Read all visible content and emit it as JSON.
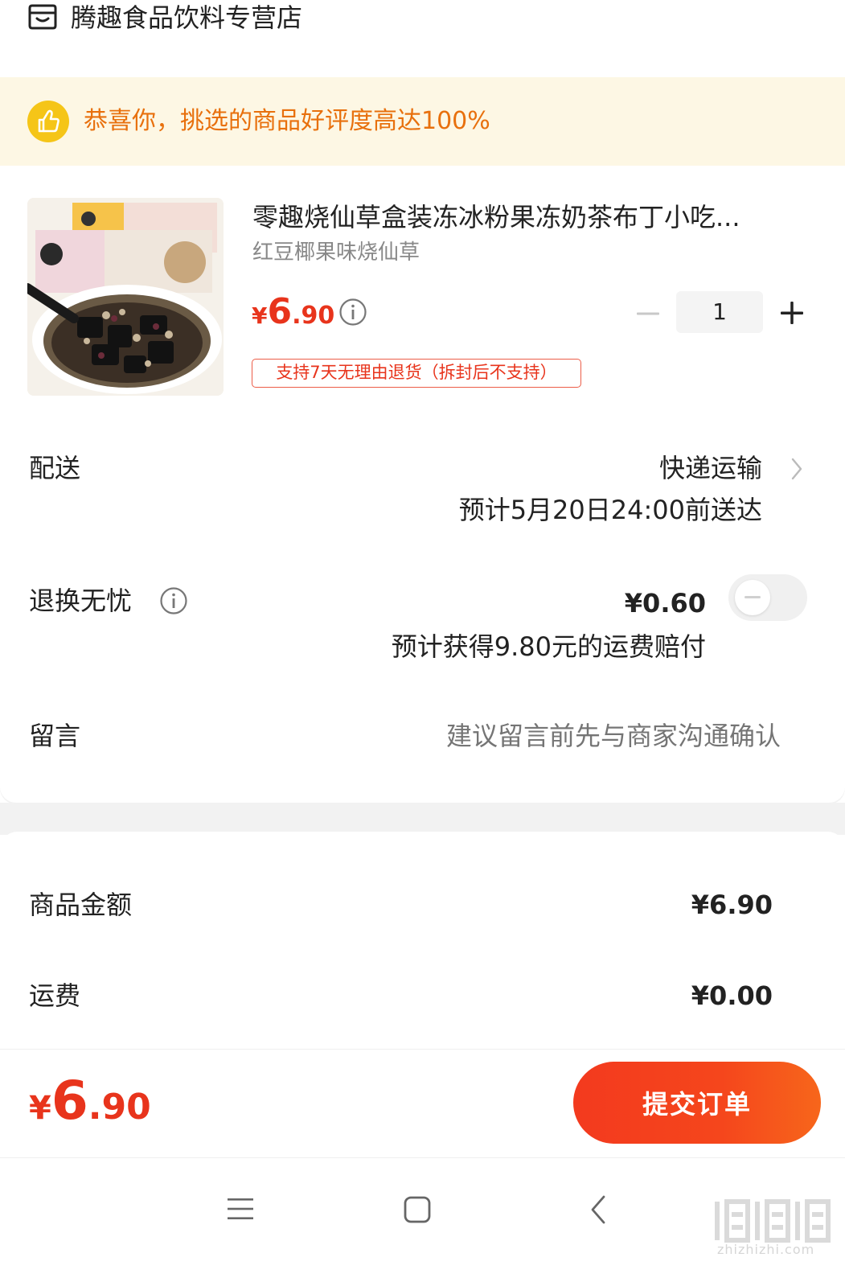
{
  "store": {
    "name": "腾趣食品饮料专营店",
    "icon": "store-icon"
  },
  "banner": {
    "text": "恭喜你，挑选的商品好评度高达100%",
    "icon": "thumbs-up-icon"
  },
  "product": {
    "title": "零趣烧仙草盒装冻冰粉果冻奶茶布丁小吃...",
    "variant": "红豆椰果味烧仙草",
    "price": {
      "currency": "¥",
      "integer": "6",
      "decimal": ".90"
    },
    "quantity": "1",
    "return_policy": "支持7天无理由退货（拆封后不支持）"
  },
  "delivery": {
    "label": "配送",
    "method": "快递运输",
    "eta": "预计5月20日24:00前送达"
  },
  "insurance": {
    "label": "退换无忧",
    "price": "¥0.60",
    "note": "预计获得9.80元的运费赔付",
    "enabled": false
  },
  "message": {
    "label": "留言",
    "placeholder": "建议留言前先与商家沟通确认"
  },
  "summary": {
    "goods_label": "商品金额",
    "goods_value": "¥6.90",
    "shipping_label": "运费",
    "shipping_value": "¥0.00"
  },
  "footer": {
    "total": {
      "currency": "¥",
      "integer": "6",
      "decimal": ".90"
    },
    "submit_label": "提交订单"
  },
  "watermark": {
    "text": "zhizhizhi.com"
  },
  "colors": {
    "accent": "#e8341c",
    "banner_bg": "#fdf7e4",
    "banner_text": "#e8700d",
    "badge": "#f5c518"
  }
}
